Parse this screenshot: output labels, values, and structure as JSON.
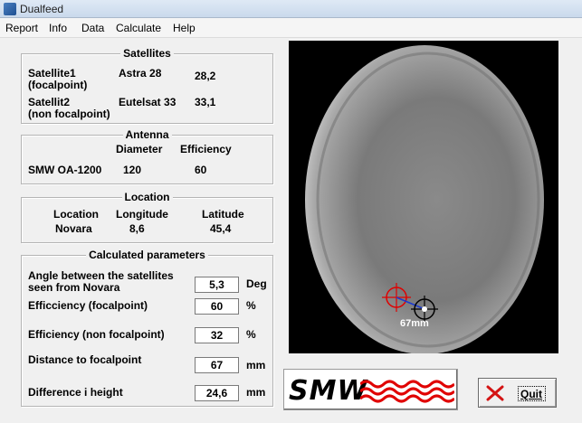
{
  "window": {
    "title": "Dualfeed"
  },
  "menu": [
    "Report",
    "Info",
    "Data",
    "Calculate",
    "Help"
  ],
  "satellites": {
    "title": "Satellites",
    "rows": [
      {
        "label1": "Satellite1",
        "label2": "(focalpoint)",
        "name": "Astra 28",
        "position": "28,2"
      },
      {
        "label1": "Satellit2",
        "label2": "(non focalpoint)",
        "name": "Eutelsat 33",
        "position": "33,1"
      }
    ]
  },
  "antenna": {
    "title": "Antenna",
    "col_diameter": "Diameter",
    "col_efficiency": "Efficiency",
    "model": "SMW OA-1200",
    "diameter": "120",
    "efficiency": "60"
  },
  "location": {
    "title": "Location",
    "col_location": "Location",
    "col_longitude": "Longitude",
    "col_latitude": "Latitude",
    "name": "Novara",
    "longitude": "8,6",
    "latitude": "45,4"
  },
  "calculated": {
    "title": "Calculated parameters",
    "rows": [
      {
        "label_line1": "Angle between the satellites",
        "label_line2": "seen from Novara",
        "value": "5,3",
        "unit": "Deg"
      },
      {
        "label_line1": "Efficciency  (focalpoint)",
        "label_line2": "",
        "value": "60",
        "unit": "%"
      },
      {
        "label_line1": "Efficiency  (non focalpoint)",
        "label_line2": "",
        "value": "32",
        "unit": "%"
      },
      {
        "label_line1": "Distance to focalpoint",
        "label_line2": "",
        "value": "67",
        "unit": "mm"
      },
      {
        "label_line1": "Difference i height",
        "label_line2": "",
        "value": "24,6",
        "unit": "mm"
      }
    ]
  },
  "dish_view": {
    "marker_label": "67mm",
    "focal_marker_color": "#e00000",
    "feed_marker_color": "#ffffff"
  },
  "logo": {
    "text": "SMW",
    "wave_color": "#e00000"
  },
  "quit": {
    "label": "Quit",
    "icon": "red-x-icon",
    "icon_color": "#d41414"
  }
}
